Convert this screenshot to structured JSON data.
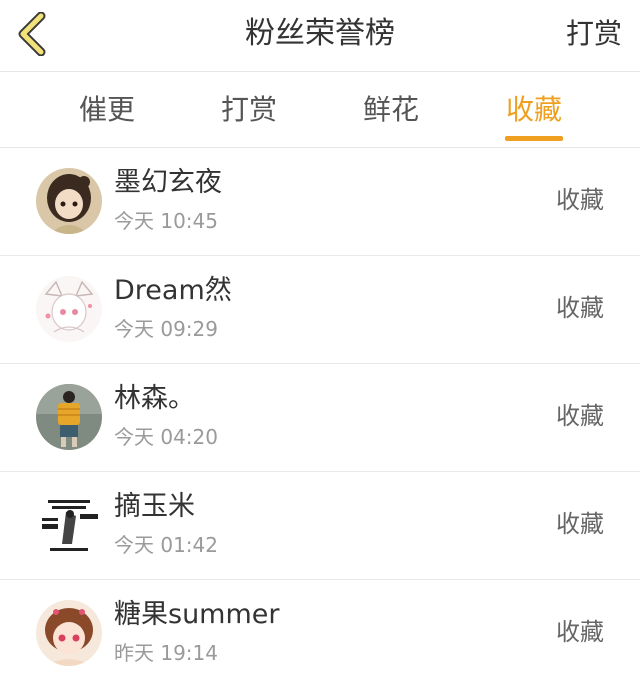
{
  "header": {
    "title": "粉丝荣誉榜",
    "action_label": "打赏",
    "accent_color": "#f0a020"
  },
  "tabs": [
    {
      "label": "催更",
      "active": false
    },
    {
      "label": "打赏",
      "active": false
    },
    {
      "label": "鲜花",
      "active": false
    },
    {
      "label": "收藏",
      "active": true
    }
  ],
  "fans": [
    {
      "name": "墨幻玄夜",
      "time": "今天 10:45",
      "action": "收藏"
    },
    {
      "name": "Dream然",
      "time": "今天 09:29",
      "action": "收藏"
    },
    {
      "name": "林森。",
      "time": "今天 04:20",
      "action": "收藏"
    },
    {
      "name": "摘玉米",
      "time": "今天 01:42",
      "action": "收藏"
    },
    {
      "name": "糖果summer",
      "time": "昨天 19:14",
      "action": "收藏"
    }
  ]
}
